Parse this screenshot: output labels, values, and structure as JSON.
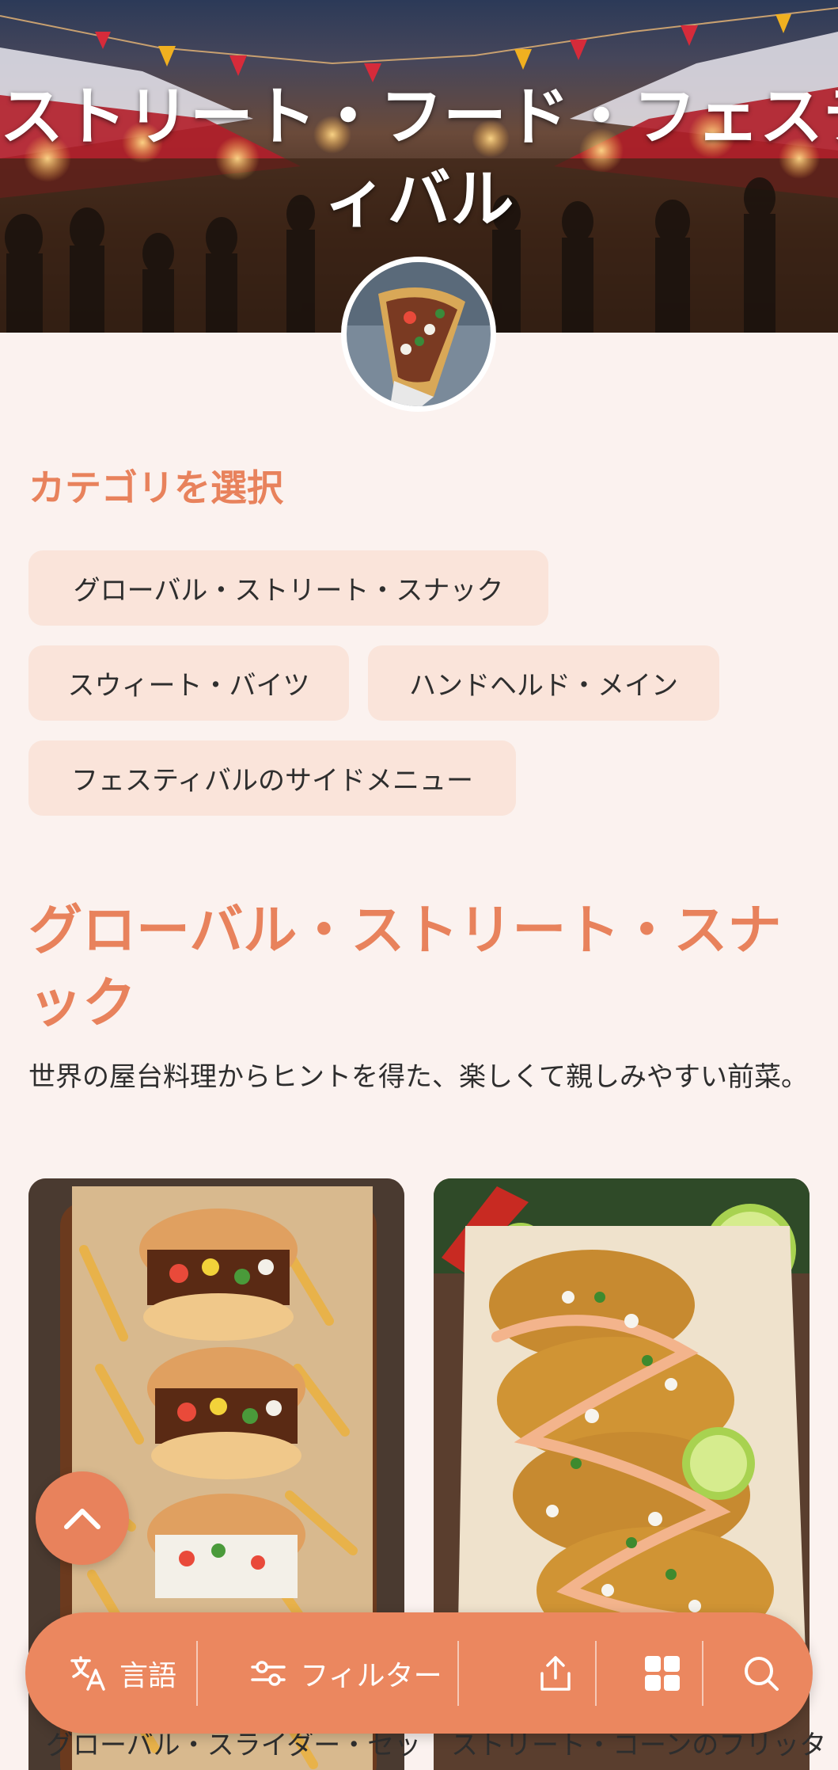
{
  "hero": {
    "title_line1": "ストリート・フード・フェステ",
    "title_line2": "ィバル"
  },
  "categories": {
    "heading": "カテゴリを選択",
    "items": [
      "グローバル・ストリート・スナック",
      "スウィート・バイツ",
      "ハンドヘルド・メイン",
      "フェスティバルのサイドメニュー"
    ]
  },
  "section": {
    "title": "グローバル・ストリート・スナック",
    "description": "世界の屋台料理からヒントを得た、楽しくて親しみやすい前菜。",
    "cards": [
      {
        "title": "グローバル・スライダー・セット"
      },
      {
        "title": "ストリート・コーンのフリッター"
      }
    ]
  },
  "bottom_bar": {
    "language_label": "言語",
    "filter_label": "フィルター",
    "icons": [
      "translate-icon",
      "sliders-icon",
      "share-icon",
      "grid-icon",
      "search-icon"
    ]
  },
  "colors": {
    "accent": "#e8825c",
    "chip_bg": "#fae4da",
    "page_bg": "#fbf2ef"
  }
}
